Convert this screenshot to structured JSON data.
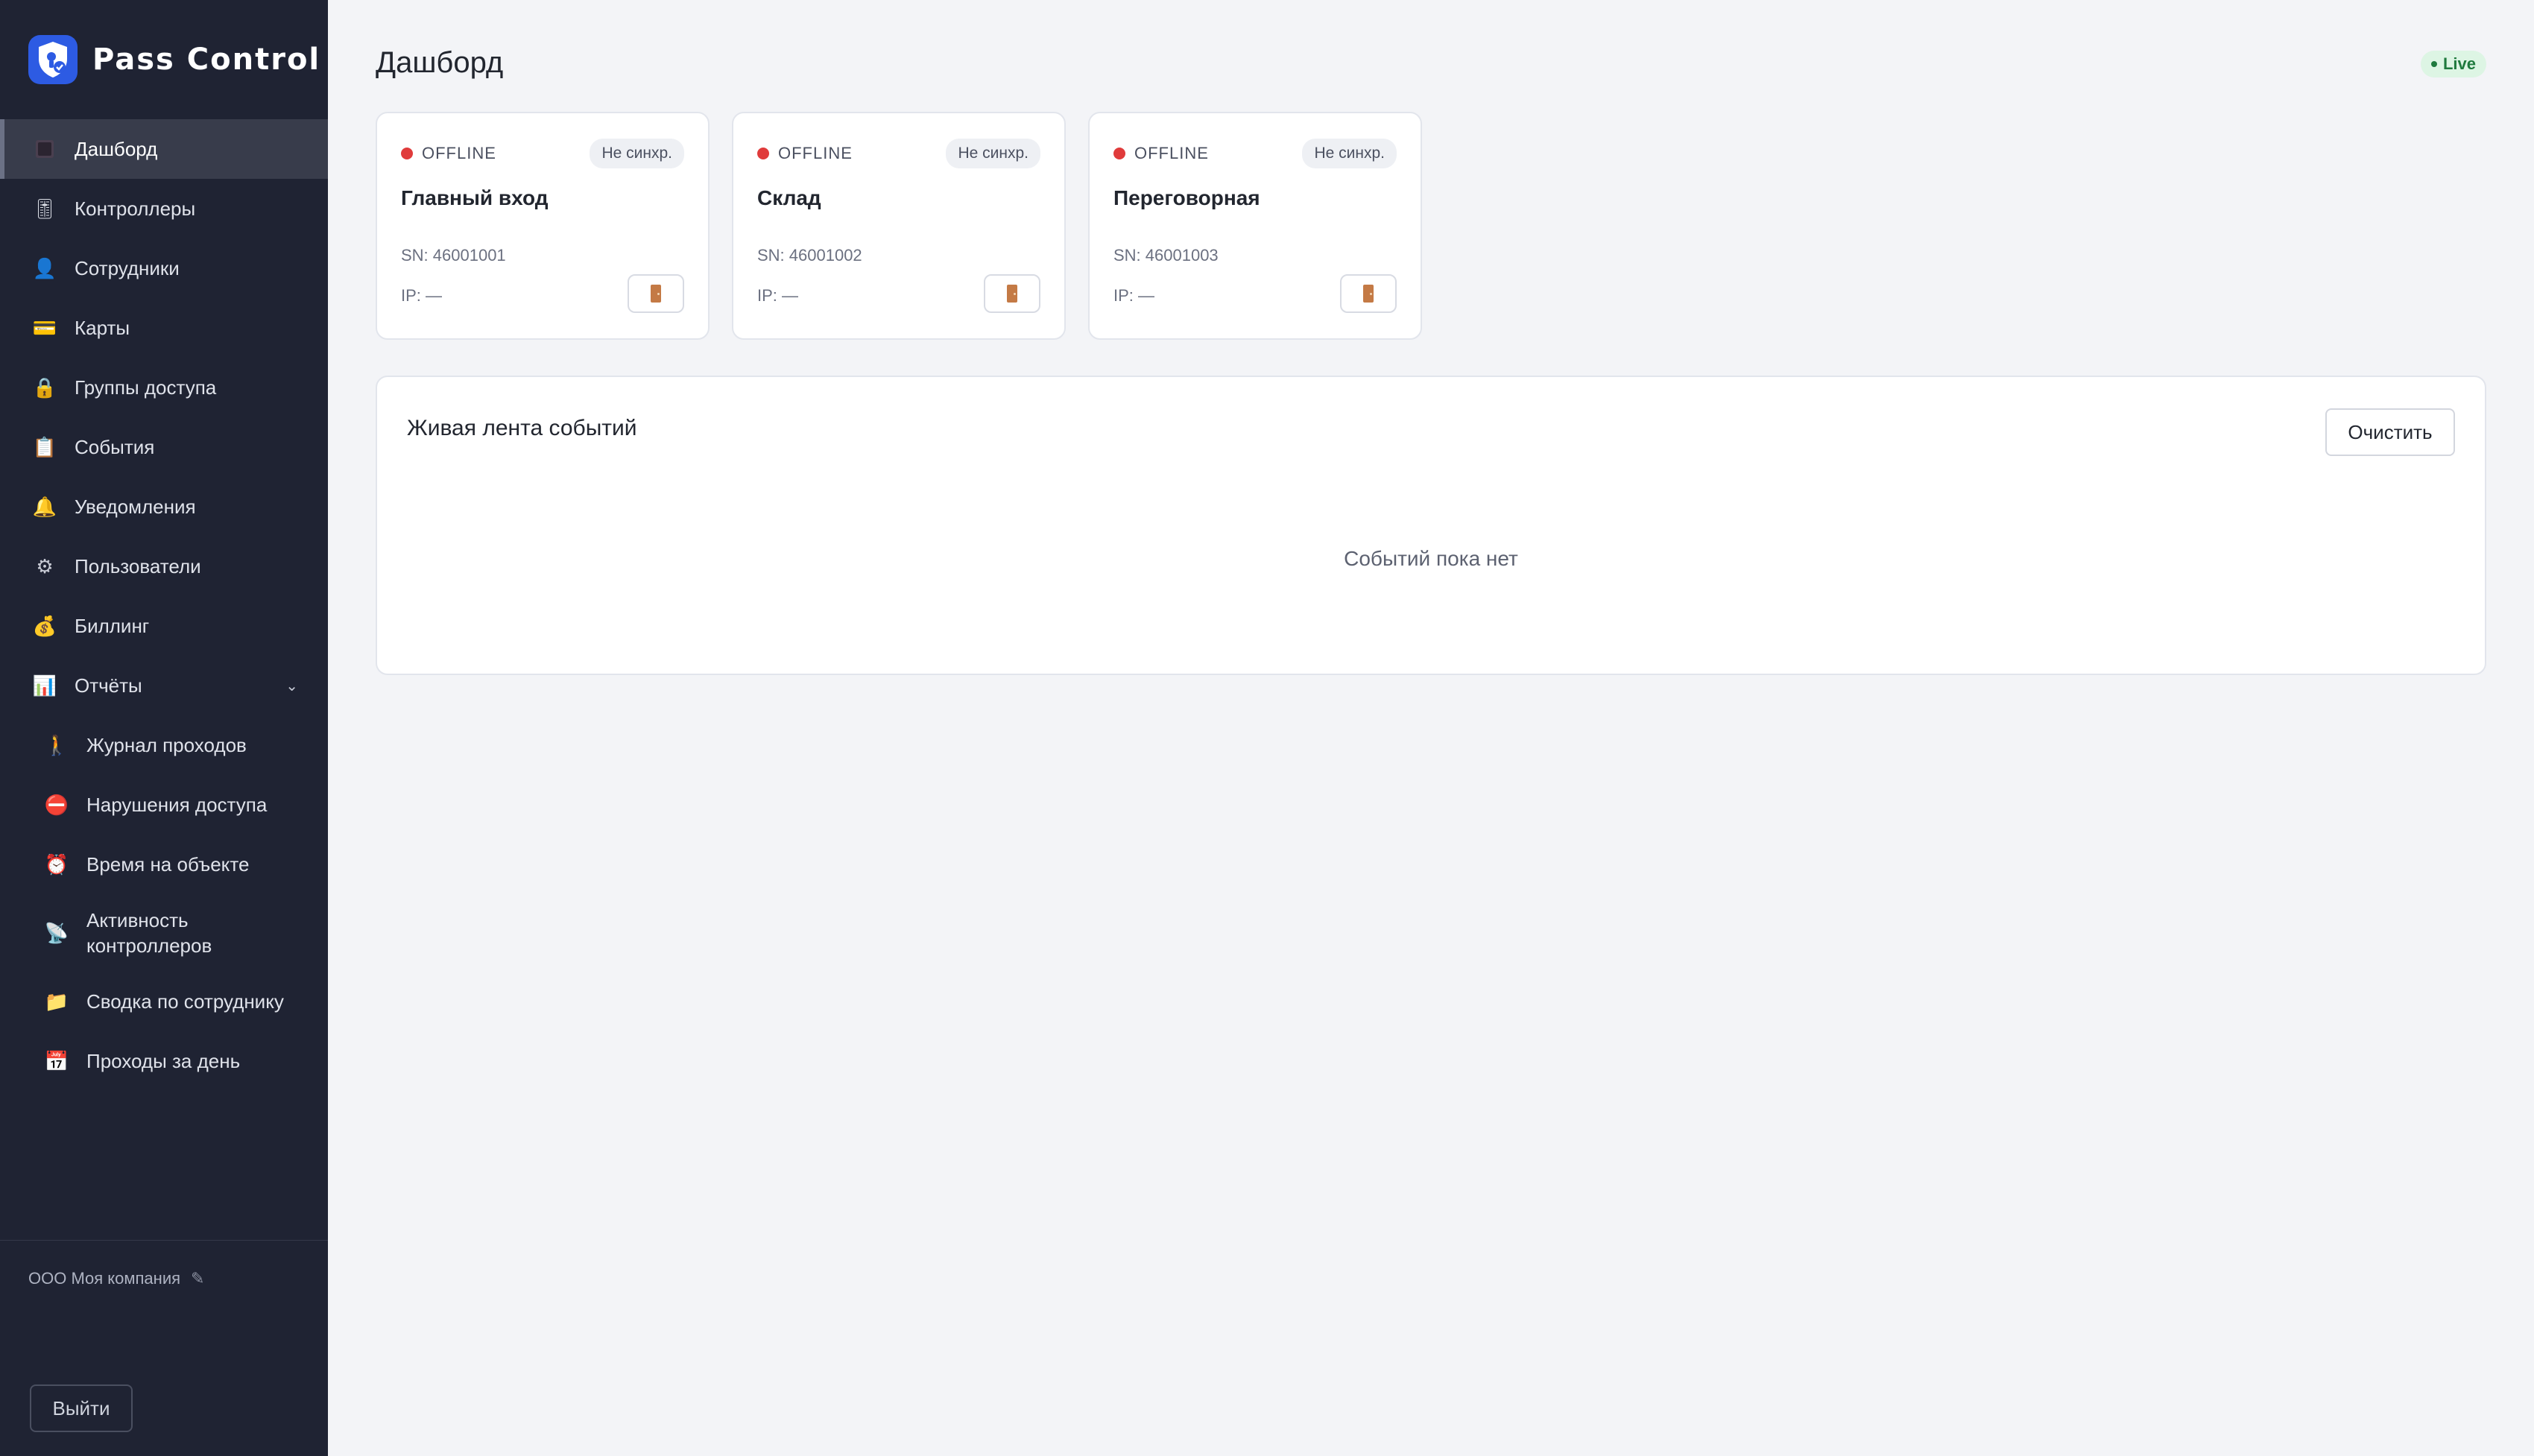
{
  "brand": {
    "title": "Pass Control"
  },
  "sidebar": {
    "items": [
      {
        "label": "Дашборд",
        "icon": "dashboard-icon",
        "glyph": "▪"
      },
      {
        "label": "Контроллеры",
        "icon": "controller-icon",
        "glyph": "🎚"
      },
      {
        "label": "Сотрудники",
        "icon": "person-icon",
        "glyph": "👤"
      },
      {
        "label": "Карты",
        "icon": "card-icon",
        "glyph": "💳"
      },
      {
        "label": "Группы доступа",
        "icon": "lock-icon",
        "glyph": "🔒"
      },
      {
        "label": "События",
        "icon": "clipboard-icon",
        "glyph": "📋"
      },
      {
        "label": "Уведомления",
        "icon": "bell-icon",
        "glyph": "🔔"
      },
      {
        "label": "Пользователи",
        "icon": "gear-icon",
        "glyph": "⚙"
      },
      {
        "label": "Биллинг",
        "icon": "money-bag-icon",
        "glyph": "💰"
      },
      {
        "label": "Отчёты",
        "icon": "bar-chart-icon",
        "glyph": "📊"
      }
    ],
    "reports_sub": [
      {
        "label": "Журнал проходов",
        "icon": "walking-person-icon",
        "glyph": "🚶"
      },
      {
        "label": "Нарушения доступа",
        "icon": "no-entry-icon",
        "glyph": "⛔"
      },
      {
        "label": "Время на объекте",
        "icon": "alarm-clock-icon",
        "glyph": "⏰"
      },
      {
        "label": "Активность контроллеров",
        "icon": "satellite-icon",
        "glyph": "📡"
      },
      {
        "label": "Сводка по сотруднику",
        "icon": "folder-icon",
        "glyph": "📁"
      },
      {
        "label": "Проходы за день",
        "icon": "calendar-icon",
        "glyph": "📅"
      }
    ],
    "company": "ООО Моя компания",
    "logout_label": "Выйти"
  },
  "header": {
    "title": "Дашборд",
    "live_label": "Live"
  },
  "controllers": [
    {
      "status": "OFFLINE",
      "sync": "Не синхр.",
      "name": "Главный вход",
      "sn": "SN: 46001001",
      "ip": "IP: —"
    },
    {
      "status": "OFFLINE",
      "sync": "Не синхр.",
      "name": "Склад",
      "sn": "SN: 46001002",
      "ip": "IP: —"
    },
    {
      "status": "OFFLINE",
      "sync": "Не синхр.",
      "name": "Переговорная",
      "sn": "SN: 46001003",
      "ip": "IP: —"
    }
  ],
  "feed": {
    "title": "Живая лента событий",
    "clear_label": "Очистить",
    "empty_text": "Событий пока нет"
  },
  "colors": {
    "sidebar_bg": "#1f2333",
    "offline": "#e03b3b",
    "live_bg": "#ddf5e4",
    "live_text": "#1f7a3e"
  }
}
